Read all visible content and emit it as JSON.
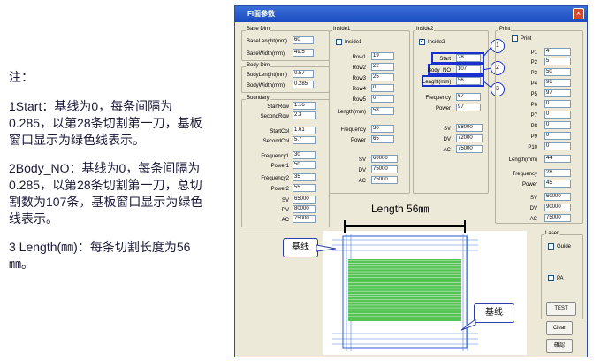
{
  "notes": {
    "title": "注：",
    "items": [
      "1Start：基线为0，每条间隔为0.285，以第28条切割第一刀，基板窗口显示为绿色线表示。",
      "2Body_NO：基线为0，每条间隔为0.285，以第28条切割第一刀，总切割数为107条，基板窗口显示为绿色线表示。",
      "3 Length(㎜)：每条切割长度为56㎜。"
    ]
  },
  "window": {
    "title": "FI面参数",
    "close": "×",
    "base_dim": {
      "label": "Base Dim",
      "rows": [
        {
          "label": "BaseLenght(mm)",
          "value": "60"
        },
        {
          "label": "BaseWidth(mm)",
          "value": "49.5"
        }
      ]
    },
    "body_dim": {
      "label": "Body Dim",
      "rows": [
        {
          "label": "BodyLenght(mm)",
          "value": "0.57"
        },
        {
          "label": "BodyWidth(mm)",
          "value": "0.285"
        }
      ]
    },
    "boundary": {
      "label": "Boundary",
      "rows": [
        {
          "label": "StartRow",
          "value": "1.16"
        },
        {
          "label": "SecondRow",
          "value": "2.3"
        },
        {
          "label": "StartCol",
          "value": "1.61"
        },
        {
          "label": "SecondCol",
          "value": "5.7"
        },
        {
          "label": "Frequency1",
          "value": "30"
        },
        {
          "label": "Power1",
          "value": "50"
        },
        {
          "label": "Frequency2",
          "value": "35"
        },
        {
          "label": "Power2",
          "value": "55"
        },
        {
          "label": "SV",
          "value": "65000"
        },
        {
          "label": "DV",
          "value": "80000"
        },
        {
          "label": "AC",
          "value": "75000"
        }
      ]
    },
    "inside1": {
      "label": "Inside1",
      "check_label": "Inside1",
      "checked": "",
      "rows": [
        {
          "label": "Row1",
          "value": "19"
        },
        {
          "label": "Row2",
          "value": "22"
        },
        {
          "label": "Row3",
          "value": "25"
        },
        {
          "label": "Row4",
          "value": "0"
        },
        {
          "label": "Row5",
          "value": "0"
        },
        {
          "label": "Length(mm)",
          "value": "58"
        },
        {
          "label": "Frequency",
          "value": "30"
        },
        {
          "label": "Power",
          "value": "65"
        },
        {
          "label": "SV",
          "value": "60000"
        },
        {
          "label": "DV",
          "value": "75000"
        },
        {
          "label": "AC",
          "value": "75000"
        }
      ]
    },
    "inside2": {
      "label": "Inside2",
      "check_label": "Inside2",
      "checked": "✓",
      "rows": [
        {
          "label": "Start",
          "value": "28"
        },
        {
          "label": "Body_NO",
          "value": "107"
        },
        {
          "label": "Lenght(mm)",
          "value": "56"
        },
        {
          "label": "Frequency",
          "value": "67"
        },
        {
          "label": "Power",
          "value": "97"
        },
        {
          "label": "SV",
          "value": "58000"
        },
        {
          "label": "DV",
          "value": "72000"
        },
        {
          "label": "AC",
          "value": "75000"
        }
      ]
    },
    "print": {
      "label": "Print",
      "check_label": "Print",
      "checked": "",
      "rows": [
        {
          "label": "P1",
          "value": "4"
        },
        {
          "label": "P2",
          "value": "5"
        },
        {
          "label": "P3",
          "value": "50"
        },
        {
          "label": "P4",
          "value": "96"
        },
        {
          "label": "P5",
          "value": "97"
        },
        {
          "label": "P6",
          "value": "0"
        },
        {
          "label": "P7",
          "value": "0"
        },
        {
          "label": "P8",
          "value": "0"
        },
        {
          "label": "P9",
          "value": "0"
        },
        {
          "label": "P10",
          "value": "0"
        },
        {
          "label": "Length(mm)",
          "value": "44"
        },
        {
          "label": "Frequency",
          "value": "28"
        },
        {
          "label": "Power",
          "value": "45"
        },
        {
          "label": "SV",
          "value": "60000"
        },
        {
          "label": "DV",
          "value": "90000"
        },
        {
          "label": "AC",
          "value": "75000"
        }
      ]
    },
    "laser": {
      "label": "Laser",
      "guide": "Guide",
      "pa": "PA",
      "test": "TEST"
    },
    "clear": "Clear",
    "confirm": "確認"
  },
  "annotations": {
    "markers": [
      "1",
      "2",
      "3"
    ],
    "length_label": "Length 56㎜",
    "baseline_top": "基线",
    "baseline_bottom": "基线"
  },
  "colors": {
    "highlight": "#1a2fd0",
    "green_lines": "#55c455",
    "titlebar": "#1a4cc0"
  }
}
